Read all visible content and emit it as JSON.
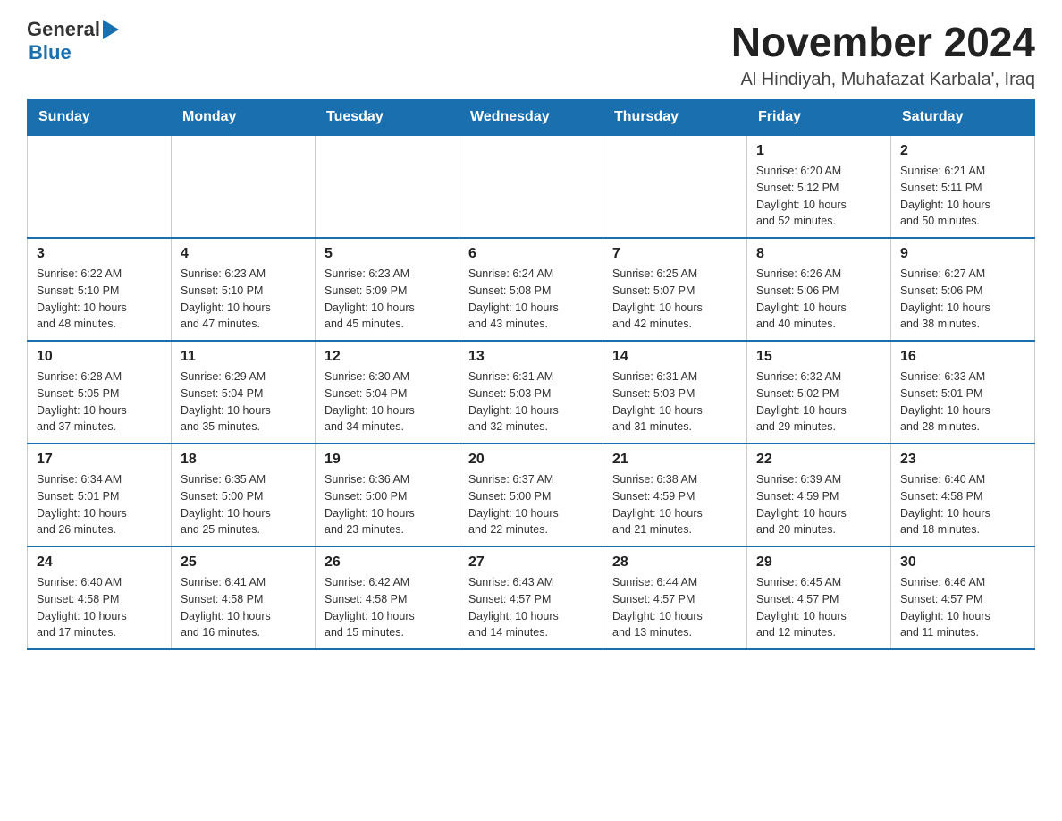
{
  "header": {
    "logo_general": "General",
    "logo_blue": "Blue",
    "main_title": "November 2024",
    "subtitle": "Al Hindiyah, Muhafazat Karbala', Iraq"
  },
  "calendar": {
    "days_of_week": [
      "Sunday",
      "Monday",
      "Tuesday",
      "Wednesday",
      "Thursday",
      "Friday",
      "Saturday"
    ],
    "weeks": [
      [
        {
          "day": "",
          "info": ""
        },
        {
          "day": "",
          "info": ""
        },
        {
          "day": "",
          "info": ""
        },
        {
          "day": "",
          "info": ""
        },
        {
          "day": "",
          "info": ""
        },
        {
          "day": "1",
          "info": "Sunrise: 6:20 AM\nSunset: 5:12 PM\nDaylight: 10 hours\nand 52 minutes."
        },
        {
          "day": "2",
          "info": "Sunrise: 6:21 AM\nSunset: 5:11 PM\nDaylight: 10 hours\nand 50 minutes."
        }
      ],
      [
        {
          "day": "3",
          "info": "Sunrise: 6:22 AM\nSunset: 5:10 PM\nDaylight: 10 hours\nand 48 minutes."
        },
        {
          "day": "4",
          "info": "Sunrise: 6:23 AM\nSunset: 5:10 PM\nDaylight: 10 hours\nand 47 minutes."
        },
        {
          "day": "5",
          "info": "Sunrise: 6:23 AM\nSunset: 5:09 PM\nDaylight: 10 hours\nand 45 minutes."
        },
        {
          "day": "6",
          "info": "Sunrise: 6:24 AM\nSunset: 5:08 PM\nDaylight: 10 hours\nand 43 minutes."
        },
        {
          "day": "7",
          "info": "Sunrise: 6:25 AM\nSunset: 5:07 PM\nDaylight: 10 hours\nand 42 minutes."
        },
        {
          "day": "8",
          "info": "Sunrise: 6:26 AM\nSunset: 5:06 PM\nDaylight: 10 hours\nand 40 minutes."
        },
        {
          "day": "9",
          "info": "Sunrise: 6:27 AM\nSunset: 5:06 PM\nDaylight: 10 hours\nand 38 minutes."
        }
      ],
      [
        {
          "day": "10",
          "info": "Sunrise: 6:28 AM\nSunset: 5:05 PM\nDaylight: 10 hours\nand 37 minutes."
        },
        {
          "day": "11",
          "info": "Sunrise: 6:29 AM\nSunset: 5:04 PM\nDaylight: 10 hours\nand 35 minutes."
        },
        {
          "day": "12",
          "info": "Sunrise: 6:30 AM\nSunset: 5:04 PM\nDaylight: 10 hours\nand 34 minutes."
        },
        {
          "day": "13",
          "info": "Sunrise: 6:31 AM\nSunset: 5:03 PM\nDaylight: 10 hours\nand 32 minutes."
        },
        {
          "day": "14",
          "info": "Sunrise: 6:31 AM\nSunset: 5:03 PM\nDaylight: 10 hours\nand 31 minutes."
        },
        {
          "day": "15",
          "info": "Sunrise: 6:32 AM\nSunset: 5:02 PM\nDaylight: 10 hours\nand 29 minutes."
        },
        {
          "day": "16",
          "info": "Sunrise: 6:33 AM\nSunset: 5:01 PM\nDaylight: 10 hours\nand 28 minutes."
        }
      ],
      [
        {
          "day": "17",
          "info": "Sunrise: 6:34 AM\nSunset: 5:01 PM\nDaylight: 10 hours\nand 26 minutes."
        },
        {
          "day": "18",
          "info": "Sunrise: 6:35 AM\nSunset: 5:00 PM\nDaylight: 10 hours\nand 25 minutes."
        },
        {
          "day": "19",
          "info": "Sunrise: 6:36 AM\nSunset: 5:00 PM\nDaylight: 10 hours\nand 23 minutes."
        },
        {
          "day": "20",
          "info": "Sunrise: 6:37 AM\nSunset: 5:00 PM\nDaylight: 10 hours\nand 22 minutes."
        },
        {
          "day": "21",
          "info": "Sunrise: 6:38 AM\nSunset: 4:59 PM\nDaylight: 10 hours\nand 21 minutes."
        },
        {
          "day": "22",
          "info": "Sunrise: 6:39 AM\nSunset: 4:59 PM\nDaylight: 10 hours\nand 20 minutes."
        },
        {
          "day": "23",
          "info": "Sunrise: 6:40 AM\nSunset: 4:58 PM\nDaylight: 10 hours\nand 18 minutes."
        }
      ],
      [
        {
          "day": "24",
          "info": "Sunrise: 6:40 AM\nSunset: 4:58 PM\nDaylight: 10 hours\nand 17 minutes."
        },
        {
          "day": "25",
          "info": "Sunrise: 6:41 AM\nSunset: 4:58 PM\nDaylight: 10 hours\nand 16 minutes."
        },
        {
          "day": "26",
          "info": "Sunrise: 6:42 AM\nSunset: 4:58 PM\nDaylight: 10 hours\nand 15 minutes."
        },
        {
          "day": "27",
          "info": "Sunrise: 6:43 AM\nSunset: 4:57 PM\nDaylight: 10 hours\nand 14 minutes."
        },
        {
          "day": "28",
          "info": "Sunrise: 6:44 AM\nSunset: 4:57 PM\nDaylight: 10 hours\nand 13 minutes."
        },
        {
          "day": "29",
          "info": "Sunrise: 6:45 AM\nSunset: 4:57 PM\nDaylight: 10 hours\nand 12 minutes."
        },
        {
          "day": "30",
          "info": "Sunrise: 6:46 AM\nSunset: 4:57 PM\nDaylight: 10 hours\nand 11 minutes."
        }
      ]
    ]
  }
}
